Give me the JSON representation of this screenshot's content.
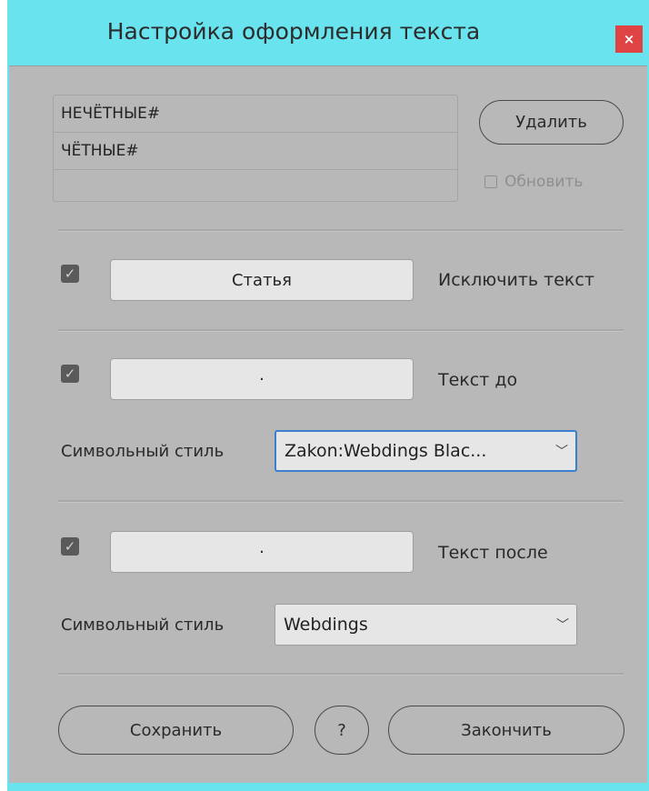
{
  "window": {
    "title": "Настройка оформления текста",
    "close_label": "×"
  },
  "list": {
    "items": [
      "НЕЧЁТНЫЕ#",
      "ЧЁТНЫЕ#",
      ""
    ]
  },
  "buttons": {
    "delete": "Удалить",
    "save": "Сохранить",
    "help": "?",
    "finish": "Закончить"
  },
  "refresh": {
    "label": "Обновить",
    "checked": false,
    "enabled": false
  },
  "exclude": {
    "checked": true,
    "value": "Статья",
    "label": "Исключить текст"
  },
  "before": {
    "checked": true,
    "value": "·",
    "label": "Текст до",
    "style_label": "Символьный стиль",
    "style_value": "Zakon:Webdings Blac..."
  },
  "after": {
    "checked": true,
    "value": "·",
    "label": "Текст после",
    "style_label": "Символьный стиль",
    "style_value": "Webdings"
  },
  "icons": {
    "check": "check-icon",
    "chevron": "chevron-down-icon",
    "close": "close-icon"
  },
  "colors": {
    "title_bar": "#69e3ee",
    "panel": "#b8b8b8",
    "close_button": "#e04343",
    "focus_border": "#3c7fd0"
  }
}
